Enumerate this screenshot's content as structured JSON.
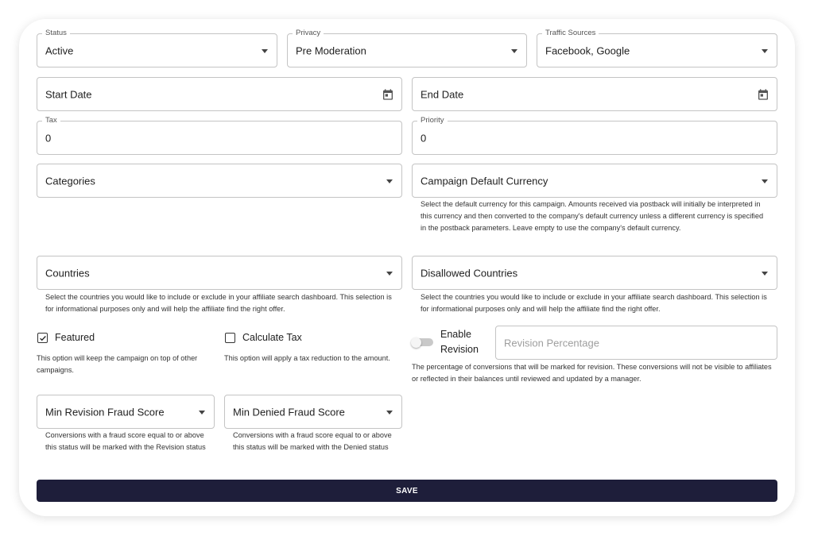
{
  "status": {
    "label": "Status",
    "value": "Active"
  },
  "privacy": {
    "label": "Privacy",
    "value": "Pre Moderation"
  },
  "traffic_sources": {
    "label": "Traffic Sources",
    "value": "Facebook, Google"
  },
  "start_date": {
    "placeholder": "Start Date"
  },
  "end_date": {
    "placeholder": "End Date"
  },
  "tax": {
    "label": "Tax",
    "value": "0"
  },
  "priority": {
    "label": "Priority",
    "value": "0"
  },
  "categories": {
    "placeholder": "Categories"
  },
  "default_currency": {
    "placeholder": "Campaign Default Currency",
    "help": "Select the default currency for this campaign. Amounts received via postback will initially be interpreted in this currency and then converted to the company's default currency unless a different currency is specified in the postback parameters. Leave empty to use the company's default currency."
  },
  "countries": {
    "placeholder": "Countries",
    "help": "Select the countries you would like to include or exclude in your affiliate search dashboard. This selection is for informational purposes only and will help the affiliate find the right offer."
  },
  "disallowed_countries": {
    "placeholder": "Disallowed Countries",
    "help": "Select the countries you would like to include or exclude in your affiliate search dashboard. This selection is for informational purposes only and will help the affiliate find the right offer."
  },
  "featured": {
    "label": "Featured",
    "checked": true,
    "help": "This option will keep the campaign on top of other campaigns."
  },
  "calculate_tax": {
    "label": "Calculate Tax",
    "checked": false,
    "help": "This option will apply a tax reduction to the amount."
  },
  "enable_revision": {
    "label_line1": "Enable",
    "label_line2": "Revision",
    "on": false
  },
  "revision_percentage": {
    "placeholder": "Revision Percentage",
    "help": "The percentage of conversions that will be marked for revision. These conversions will not be visible to affiliates or reflected in their balances until reviewed and updated by a manager."
  },
  "min_revision_fraud": {
    "placeholder": "Min Revision Fraud Score",
    "help": "Conversions with a fraud score equal to or above this status will be marked with the Revision status"
  },
  "min_denied_fraud": {
    "placeholder": "Min Denied Fraud Score",
    "help": "Conversions with a fraud score equal to or above this status will be marked with the Denied status"
  },
  "save_label": "SAVE",
  "colors": {
    "save_bg": "#1e1e3a",
    "border": "#c4c4c4"
  },
  "icons": [
    "calendar-icon",
    "chevron-down-icon",
    "checkbox-checked-icon"
  ]
}
